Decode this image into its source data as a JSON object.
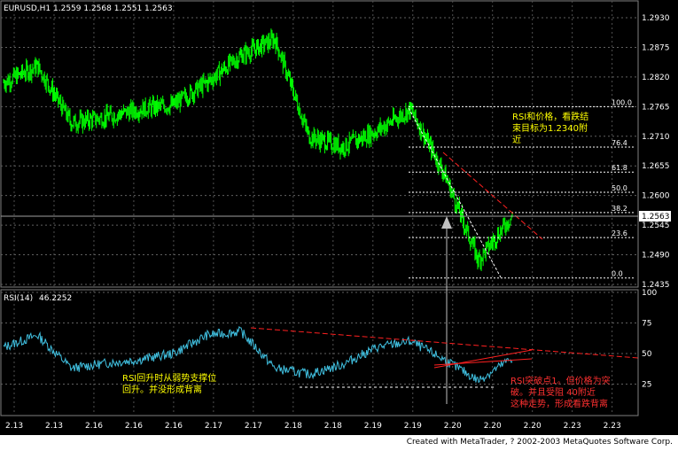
{
  "header": {
    "symbol": "EURUSD,H1",
    "ohlc": "1.2559 1.2568 1.2551 1.2563"
  },
  "rsi": {
    "label": "RSI(14)",
    "value": "46.2252",
    "levels": [
      "100",
      "75",
      "50",
      "25"
    ]
  },
  "price_axis": {
    "ticks": [
      "1.2930",
      "1.2875",
      "1.2820",
      "1.2765",
      "1.2710",
      "1.2655",
      "1.2600",
      "1.2545",
      "1.2490",
      "1.2435"
    ],
    "current": "1.2563"
  },
  "fib": {
    "levels": [
      "100.0",
      "76.4",
      "61.8",
      "50.0",
      "38.2",
      "23.6",
      "0.0"
    ]
  },
  "time_axis": {
    "labels": [
      "2.13",
      "2.13",
      "2.16",
      "2.16",
      "2.16",
      "2.17",
      "2.17",
      "2.18",
      "2.18",
      "2.19",
      "2.19",
      "2.20",
      "2.20",
      "2.20",
      "2.23",
      "2.23"
    ]
  },
  "notes": {
    "price_note_lines": [
      "RSI和价格，看跌结",
      "束目标为1.2340附",
      "近"
    ],
    "rsi_left_lines": [
      "RSI回升时从弱势支撑位",
      "回升。并没形成背离"
    ],
    "rsi_right_lines": [
      "RSI突破点1。但价格为突",
      "破。并且受阻 40附近",
      "这种走势，形成看跌背离"
    ]
  },
  "footer": "Created with MetaTrader, ? 2002-2003 MetaQuotes Software Corp.",
  "colors": {
    "background": "#000000",
    "candles": "#00ff00",
    "rsi_line": "#40c0e0",
    "trend_red": "#ff2020",
    "note_yellow": "#ffff00",
    "note_red": "#ff3030"
  },
  "chart_data": [
    {
      "type": "line",
      "x": [
        "2.13",
        "2.13",
        "2.16",
        "2.16",
        "2.16",
        "2.17",
        "2.17",
        "2.18",
        "2.18",
        "2.19",
        "2.19",
        "2.20",
        "2.20",
        "2.20",
        "2.23",
        "2.23"
      ],
      "series": [
        {
          "values": [
            1.281,
            1.284,
            1.2735,
            1.2745,
            1.276,
            1.2768,
            1.281,
            1.286,
            1.289,
            1.271,
            1.269,
            1.272,
            1.276,
            1.264,
            1.248,
            1.2563
          ]
        }
      ],
      "ylim": [
        1.2435,
        1.293
      ],
      "grid": true
    },
    {
      "type": "line",
      "x": [
        "2.13",
        "2.13",
        "2.16",
        "2.16",
        "2.16",
        "2.17",
        "2.17",
        "2.18",
        "2.18",
        "2.19",
        "2.19",
        "2.20",
        "2.20",
        "2.20",
        "2.23",
        "2.23"
      ],
      "series": [
        {
          "values": [
            55,
            65,
            38,
            42,
            45,
            50,
            65,
            68,
            38,
            33,
            41,
            55,
            60,
            45,
            28,
            46.2252
          ]
        }
      ],
      "ylim": [
        0,
        100
      ],
      "grid": true
    }
  ]
}
